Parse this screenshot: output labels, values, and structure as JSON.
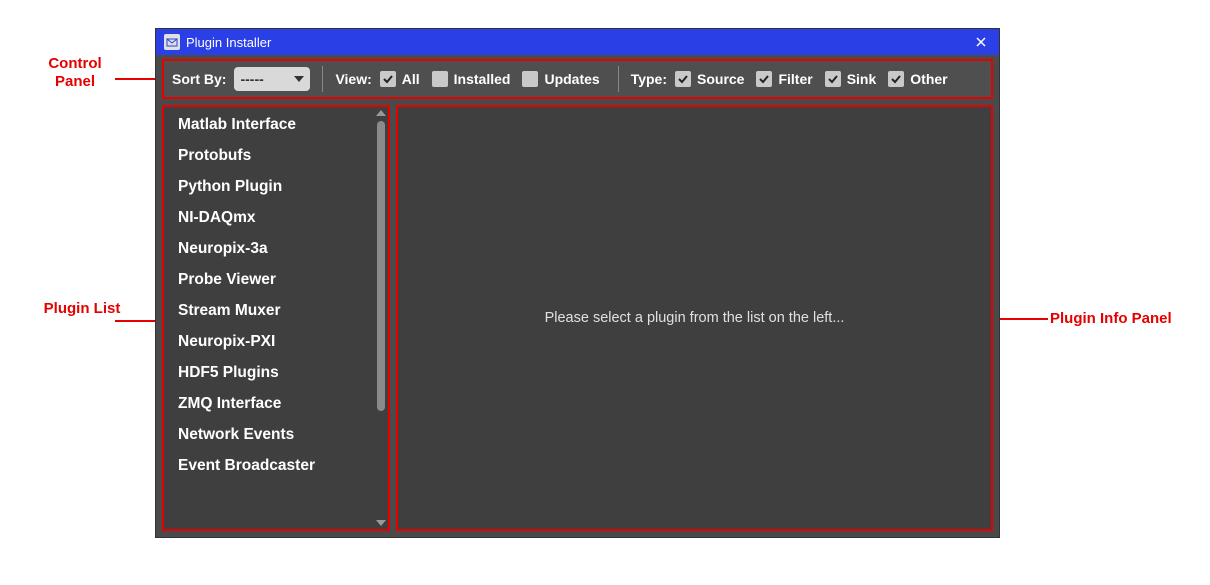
{
  "window": {
    "title": "Plugin Installer"
  },
  "control_panel": {
    "sort_label": "Sort By:",
    "sort_value": "-----",
    "view_label": "View:",
    "view_options": [
      {
        "label": "All",
        "checked": true
      },
      {
        "label": "Installed",
        "checked": false
      },
      {
        "label": "Updates",
        "checked": false
      }
    ],
    "type_label": "Type:",
    "type_options": [
      {
        "label": "Source",
        "checked": true
      },
      {
        "label": "Filter",
        "checked": true
      },
      {
        "label": "Sink",
        "checked": true
      },
      {
        "label": "Other",
        "checked": true
      }
    ]
  },
  "plugin_list": [
    "Matlab Interface",
    "Protobufs",
    "Python Plugin",
    "NI-DAQmx",
    "Neuropix-3a",
    "Probe Viewer",
    "Stream Muxer",
    "Neuropix-PXI",
    "HDF5 Plugins",
    "ZMQ Interface",
    "Network Events",
    "Event Broadcaster"
  ],
  "info_panel": {
    "placeholder": "Please select a plugin from the list on the left..."
  },
  "annotations": {
    "control_panel": "Control Panel",
    "plugin_list": "Plugin List",
    "info_panel": "Plugin Info Panel"
  }
}
